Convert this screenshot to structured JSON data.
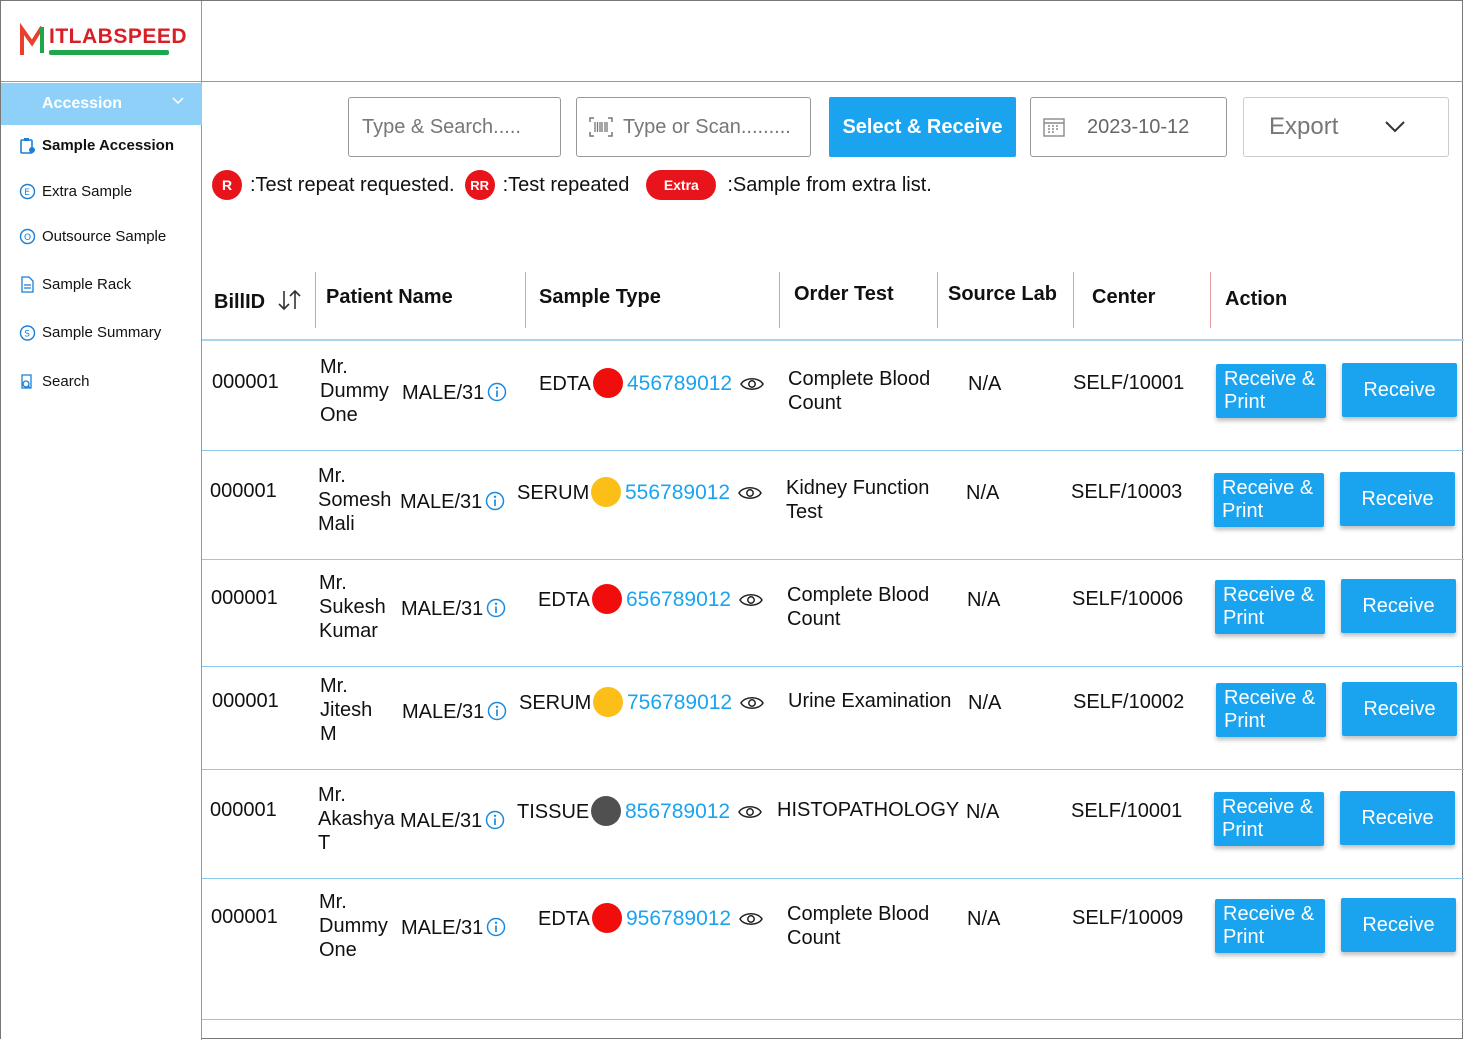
{
  "brand": {
    "name": "ITLABSPEED"
  },
  "sidebar": {
    "section": "Accession",
    "items": [
      {
        "label": "Sample Accession",
        "icon": "clipboard-icon",
        "active": true
      },
      {
        "label": "Extra Sample",
        "icon": "circle-e-icon"
      },
      {
        "label": "Outsource Sample",
        "icon": "circle-o-icon"
      },
      {
        "label": "Sample Rack",
        "icon": "document-icon"
      },
      {
        "label": "Sample Summary",
        "icon": "circle-s-icon"
      },
      {
        "label": "Search",
        "icon": "search-doc-icon"
      }
    ]
  },
  "toolbar": {
    "search_placeholder": "Type & Search.....",
    "scan_placeholder": "Type or Scan.........",
    "select_receive_label": "Select  & Receive",
    "date_value": "2023-10-12",
    "export_label": "Export"
  },
  "legend": {
    "r_badge": "R",
    "r_text": ":Test repeat requested.",
    "rr_badge": "RR",
    "rr_text": ":Test repeated",
    "extra_badge": "Extra",
    "extra_text": ":Sample from extra list."
  },
  "table": {
    "headers": {
      "bill_id": "BillID",
      "patient_name": "Patient Name",
      "sample_type": "Sample Type",
      "order_test": "Order Test",
      "source_lab": "Source Lab",
      "center": "Center",
      "action": "Action"
    },
    "rows": [
      {
        "bill_id": "000001",
        "name_l1": "Mr.",
        "name_l2": "Dummy",
        "name_l3": "One",
        "gender_age": "MALE/31",
        "sample_type": "EDTA",
        "dot_color": "#f20d0d",
        "sample_id": "456789012",
        "test_l1": "Complete Blood",
        "test_l2": "Count",
        "source_lab": "N/A",
        "center": "SELF/10001",
        "btn_receive_print_l1": "Receive &",
        "btn_receive_print_l2": "Print",
        "btn_receive": "Receive"
      },
      {
        "bill_id": "000001",
        "name_l1": "Mr.",
        "name_l2": "Somesh",
        "name_l3": "Mali",
        "gender_age": "MALE/31",
        "sample_type": "SERUM",
        "dot_color": "#fbbf18",
        "sample_id": "556789012",
        "test_l1": "Kidney Function",
        "test_l2": "Test",
        "source_lab": "N/A",
        "center": "SELF/10003",
        "btn_receive_print_l1": "Receive &",
        "btn_receive_print_l2": "Print",
        "btn_receive": "Receive"
      },
      {
        "bill_id": "000001",
        "name_l1": "Mr.",
        "name_l2": "Sukesh",
        "name_l3": "Kumar",
        "gender_age": "MALE/31",
        "sample_type": "EDTA",
        "dot_color": "#f20d0d",
        "sample_id": "656789012",
        "test_l1": "Complete Blood",
        "test_l2": "Count",
        "source_lab": "N/A",
        "center": "SELF/10006",
        "btn_receive_print_l1": "Receive &",
        "btn_receive_print_l2": "Print",
        "btn_receive": "Receive"
      },
      {
        "bill_id": "000001",
        "name_l1": "Mr.",
        "name_l2": "Jitesh",
        "name_l3": "M",
        "gender_age": "MALE/31",
        "sample_type": "SERUM",
        "dot_color": "#fbbf18",
        "sample_id": "756789012",
        "test_l1": "Urine Examination",
        "test_l2": "",
        "source_lab": "N/A",
        "center": "SELF/10002",
        "btn_receive_print_l1": "Receive &",
        "btn_receive_print_l2": "Print",
        "btn_receive": "Receive"
      },
      {
        "bill_id": "000001",
        "name_l1": "Mr.",
        "name_l2": "Akashya",
        "name_l3": "T",
        "gender_age": "MALE/31",
        "sample_type": "TISSUE",
        "dot_color": "#505050",
        "sample_id": "856789012",
        "test_l1": "HISTOPATHOLOGY",
        "test_l2": "",
        "source_lab": "N/A",
        "center": "SELF/10001",
        "btn_receive_print_l1": "Receive &",
        "btn_receive_print_l2": "Print",
        "btn_receive": "Receive"
      },
      {
        "bill_id": "000001",
        "name_l1": "Mr.",
        "name_l2": "Dummy",
        "name_l3": "One",
        "gender_age": "MALE/31",
        "sample_type": "EDTA",
        "dot_color": "#f20d0d",
        "sample_id": "956789012",
        "test_l1": "Complete Blood",
        "test_l2": "Count",
        "source_lab": "N/A",
        "center": "SELF/10009",
        "btn_receive_print_l1": "Receive &",
        "btn_receive_print_l2": "Print",
        "btn_receive": "Receive"
      }
    ]
  },
  "colors": {
    "accent": "#1aa4f0",
    "sidebar_header": "#8fd0f8",
    "badge_red": "#e8141c"
  }
}
